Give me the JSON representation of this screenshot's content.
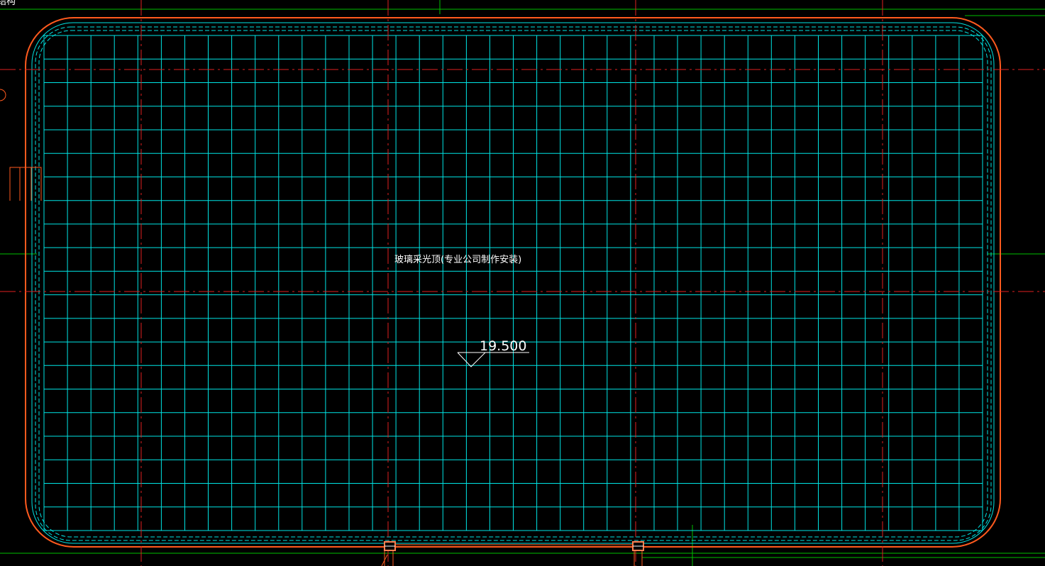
{
  "drawing": {
    "corner_label": "结构",
    "skylight_note": "玻璃采光顶(专业公司制作安装)",
    "elevation_value": "19.500"
  },
  "colors": {
    "background": "#000000",
    "grid": "#00e5e5",
    "outline": "#ff5a1e",
    "axis": "#e02020",
    "guide": "#00c000",
    "text": "#ffffff"
  },
  "icons": [
    "elevation-marker-icon",
    "column-icon"
  ]
}
